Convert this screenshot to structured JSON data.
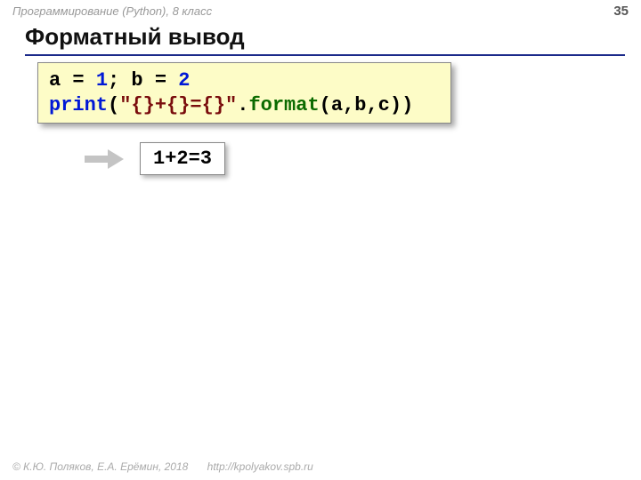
{
  "header": {
    "course": "Программирование (Python), 8 класс",
    "page_number": "35"
  },
  "title": "Форматный вывод",
  "code": {
    "line1": {
      "a": "a",
      "eq1": " = ",
      "n1": "1",
      "sep": "; ",
      "b": "b",
      "eq2": " = ",
      "n2": "2"
    },
    "line2": {
      "print": "print",
      "lp": "(",
      "str": "\"{}+{}={}\"",
      "dot": ".",
      "format": "format",
      "lp2": "(",
      "args": "a,b,c",
      "rp2": ")",
      "rp": ")"
    }
  },
  "output": "1+2=3",
  "footer": {
    "copyright": "© К.Ю. Поляков, Е.А. Ерёмин, 2018",
    "url": "http://kpolyakov.spb.ru"
  }
}
